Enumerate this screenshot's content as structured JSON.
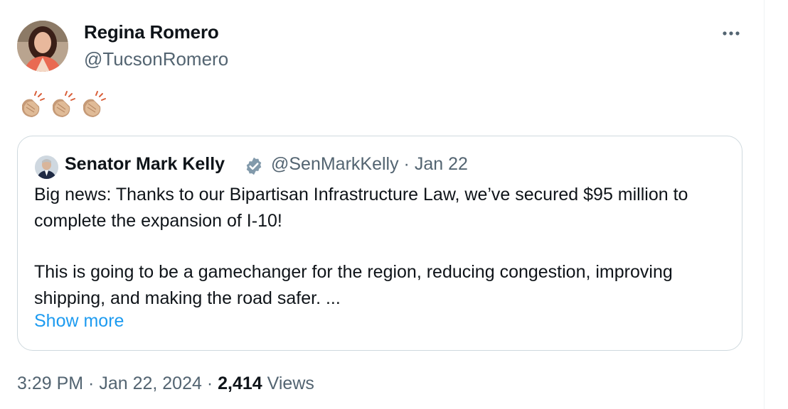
{
  "author": {
    "name": "Regina Romero",
    "handle": "@TucsonRomero"
  },
  "tweet": {
    "emoji": [
      "👏🏼",
      "👏🏼",
      "👏🏼"
    ]
  },
  "quoted_tweet": {
    "author_name": "Senator Mark Kelly",
    "handle": "@SenMarkKelly",
    "separator": " · ",
    "date": "Jan 22",
    "verified": true,
    "paragraphs": [
      "Big news: Thanks to our Bipartisan Infrastructure Law, we’ve secured $95 million to complete the expansion of I-10!",
      "This is going to be a gamechanger for the region, reducing congestion, improving shipping, and making the road safer. ..."
    ],
    "show_more_label": "Show more"
  },
  "meta": {
    "time": "3:29 PM",
    "sep1": " · ",
    "date": "Jan 22, 2024",
    "sep2": " · ",
    "views_count": "2,414",
    "views_label": " Views"
  },
  "colors": {
    "link": "#1d9bf0",
    "secondary_text": "#536471",
    "border": "#cfd9de",
    "verified_badge": "#829aab"
  },
  "icons": {
    "more": "more-dots-icon",
    "verified": "verified-badge-icon",
    "clap": "clapping-hands-icon"
  }
}
